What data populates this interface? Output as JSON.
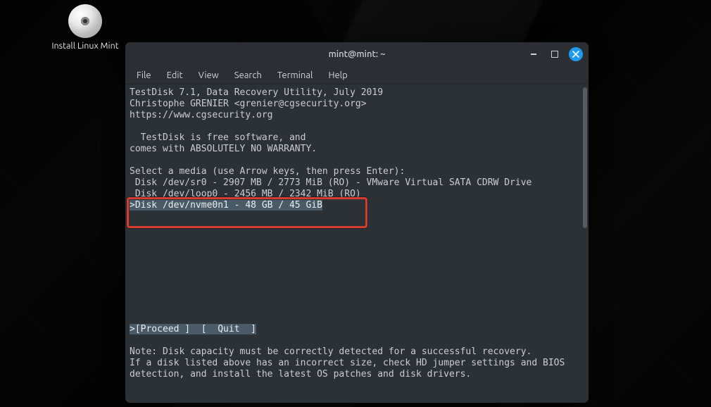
{
  "desktop": {
    "icon_label": "Install Linux Mint"
  },
  "window": {
    "title": "mint@mint: ~",
    "menu": [
      "File",
      "Edit",
      "View",
      "Search",
      "Terminal",
      "Help"
    ]
  },
  "testdisk": {
    "header": [
      "TestDisk 7.1, Data Recovery Utility, July 2019",
      "Christophe GRENIER <grenier@cgsecurity.org>",
      "https://www.cgsecurity.org"
    ],
    "notice": [
      "  TestDisk is free software, and",
      "comes with ABSOLUTELY NO WARRANTY."
    ],
    "prompt": "Select a media (use Arrow keys, then press Enter):",
    "disks": [
      " Disk /dev/sr0 - 2907 MB / 2773 MiB (RO) - VMware Virtual SATA CDRW Drive",
      " Disk /dev/loop0 - 2456 MB / 2342 MiB (RO)",
      ">Disk /dev/nvme0n1 - 48 GB / 45 GiB"
    ],
    "selected_index": 2,
    "actions_line": ">[Proceed ]  [  Quit  ]",
    "footer": [
      "Note: Disk capacity must be correctly detected for a successful recovery.",
      "If a disk listed above has an incorrect size, check HD jumper settings and BIOS",
      "detection, and install the latest OS patches and disk drivers."
    ]
  },
  "annotation": {
    "target": "selected-disk-row"
  }
}
